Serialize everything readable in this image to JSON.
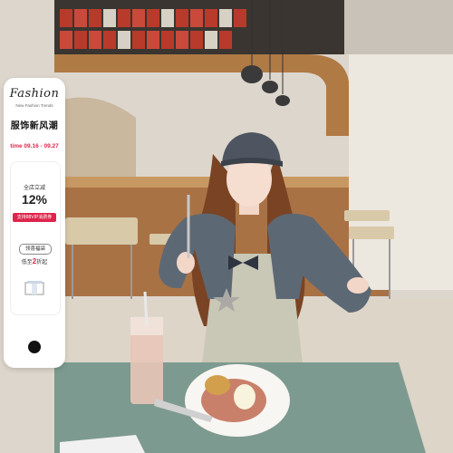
{
  "brand": {
    "script_name": "Fashion",
    "tagline": "New Fashion Trends",
    "cn_title": "服饰新风潮",
    "date_range": "time 09.16 - 09.27"
  },
  "promo": {
    "title": "全店立减",
    "percent": "12%",
    "pill_text": "支持88VIP消费券",
    "coupon_button": "领喜福袋",
    "low_price_prefix": "低至",
    "low_price_value": "2",
    "low_price_suffix": "折起"
  },
  "icons": {
    "gift": "gift-box-icon",
    "shop": "shop-cart-icon"
  },
  "colors": {
    "accent": "#e0234b",
    "table": "#7d9a90",
    "cardigan": "#5a6570"
  }
}
